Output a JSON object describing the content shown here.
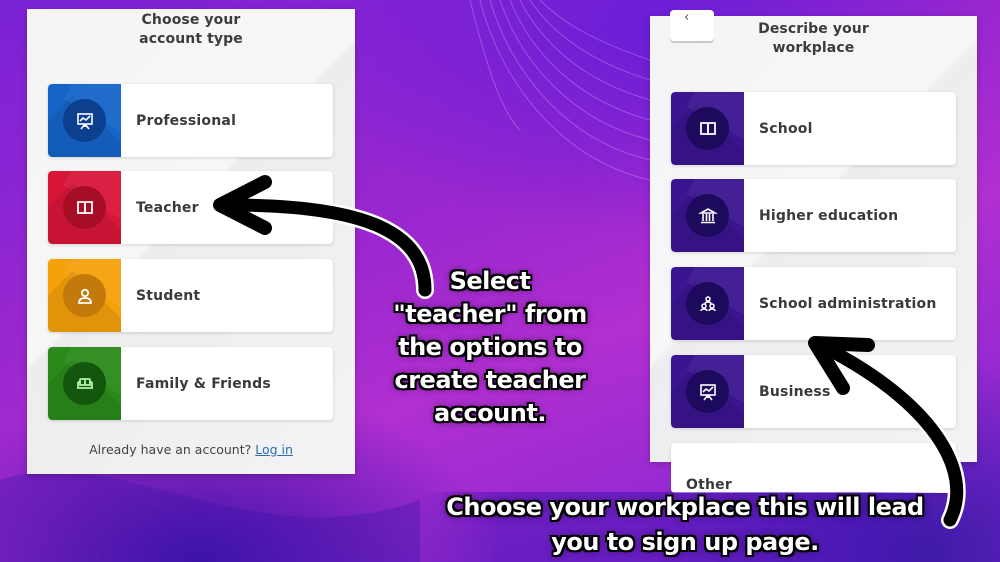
{
  "left_panel": {
    "title_lines": [
      "Choose your",
      "account type"
    ],
    "options": [
      {
        "label": "Professional",
        "icon": "presentation-board-icon",
        "tile_color": "#1565c8",
        "circle_color": "#0d3f8f"
      },
      {
        "label": "Teacher",
        "icon": "open-book-icon",
        "tile_color": "#d8163a",
        "circle_color": "#a80d26"
      },
      {
        "label": "Student",
        "icon": "person-icon",
        "tile_color": "#f5a10a",
        "circle_color": "#c47a0a"
      },
      {
        "label": "Family & Friends",
        "icon": "sofa-icon",
        "tile_color": "#2a8a1a",
        "circle_color": "#13560e"
      }
    ],
    "login_prompt": "Already have an account?",
    "login_link": "Log in"
  },
  "right_panel": {
    "back_label": "‹",
    "title_lines": [
      "Describe your",
      "workplace"
    ],
    "options": [
      {
        "label": "School",
        "icon": "open-book-icon",
        "tile_color": "#3a1591",
        "circle_color": "#1d0a5c"
      },
      {
        "label": "Higher education",
        "icon": "institution-icon",
        "tile_color": "#3a1591",
        "circle_color": "#1d0a5c"
      },
      {
        "label": "School administration",
        "icon": "group-icon",
        "tile_color": "#3a1591",
        "circle_color": "#1d0a5c"
      },
      {
        "label": "Business",
        "icon": "presentation-board-icon",
        "tile_color": "#3a1591",
        "circle_color": "#1d0a5c"
      }
    ],
    "other_label": "Other"
  },
  "captions": {
    "center_lines": [
      "Select",
      "\"teacher\" from",
      "the options to",
      "create teacher",
      "account."
    ],
    "bottom_lines": [
      "Choose your workplace this will lead",
      "you to sign up page."
    ]
  }
}
